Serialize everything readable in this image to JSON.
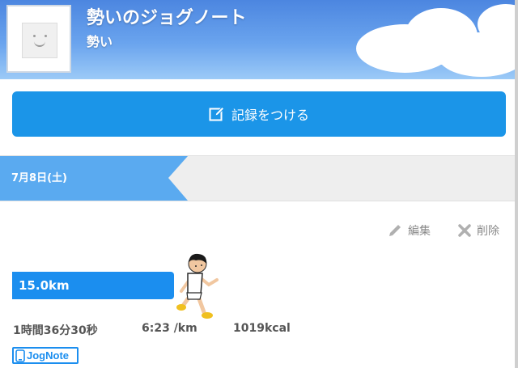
{
  "header": {
    "title": "勢いのジョグノート",
    "subtitle": "勢い",
    "sky_color": "#6aa4ee"
  },
  "record_button": {
    "label": "記録をつける",
    "icon": "pencil-square-icon",
    "color": "#1b95e8"
  },
  "entry": {
    "date": "7月8日(土)",
    "date_color": "#5aaaf0",
    "edit_label": "編集",
    "delete_label": "削除",
    "distance": "15.0km",
    "distance_fill": 1.0,
    "duration": "1時間36分30秒",
    "pace": "6:23 /km",
    "calories": "1019kcal"
  },
  "badge": {
    "label": "JogNote",
    "color": "#1b8eef"
  }
}
